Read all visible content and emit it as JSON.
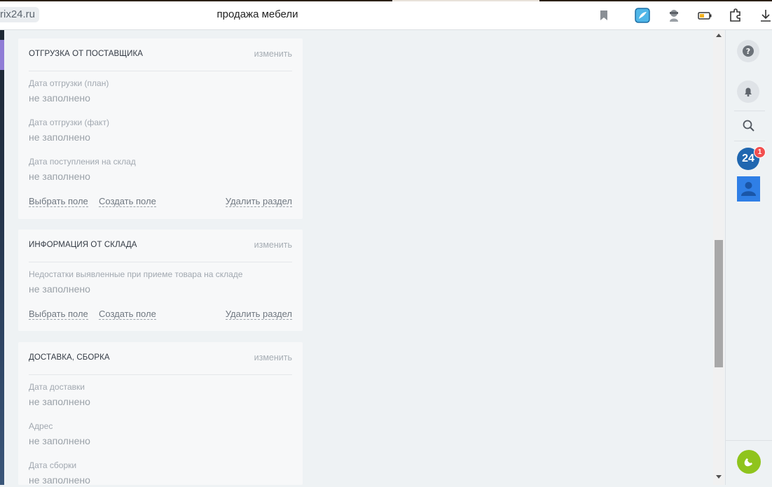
{
  "browser": {
    "url": "rix24.ru",
    "page_title": "продажа мебели"
  },
  "right_panel": {
    "b24_label": "24",
    "b24_badge": "1"
  },
  "cards": [
    {
      "title": "ОТГРУЗКА ОТ ПОСТАВЩИКА",
      "edit": "изменить",
      "fields": [
        {
          "label": "Дата отгрузки (план)",
          "value": "не заполнено"
        },
        {
          "label": "Дата отгрузки (факт)",
          "value": "не заполнено"
        },
        {
          "label": "Дата поступления на склад",
          "value": "не заполнено"
        }
      ],
      "actions": {
        "select": "Выбрать поле",
        "create": "Создать поле",
        "delete": "Удалить раздел"
      }
    },
    {
      "title": "ИНФОРМАЦИЯ ОТ СКЛАДА",
      "edit": "изменить",
      "fields": [
        {
          "label": "Недостатки выявленные при приеме товара на складе",
          "value": "не заполнено"
        }
      ],
      "actions": {
        "select": "Выбрать поле",
        "create": "Создать поле",
        "delete": "Удалить раздел"
      }
    },
    {
      "title": "ДОСТАВКА, СБОРКА",
      "edit": "изменить",
      "fields": [
        {
          "label": "Дата доставки",
          "value": "не заполнено"
        },
        {
          "label": "Адрес",
          "value": "не заполнено"
        },
        {
          "label": "Дата сборки",
          "value": "не заполнено"
        }
      ]
    }
  ],
  "icons": {
    "bookmark": "bookmark-icon",
    "extension1": "bird-extension-icon",
    "extension2": "spy-extension-icon",
    "battery": "battery-icon",
    "extension3": "puzzle-extension-icon",
    "download": "download-icon",
    "help": "help-icon",
    "notifications": "bell-icon",
    "search": "search-icon",
    "avatar": "user-icon",
    "phone": "phone-icon"
  },
  "colors": {
    "b24_blue": "#2067b0",
    "badge_red": "#f24f4f",
    "phone_green": "#8fc41d",
    "avatar_blue": "#2f7fe6"
  }
}
